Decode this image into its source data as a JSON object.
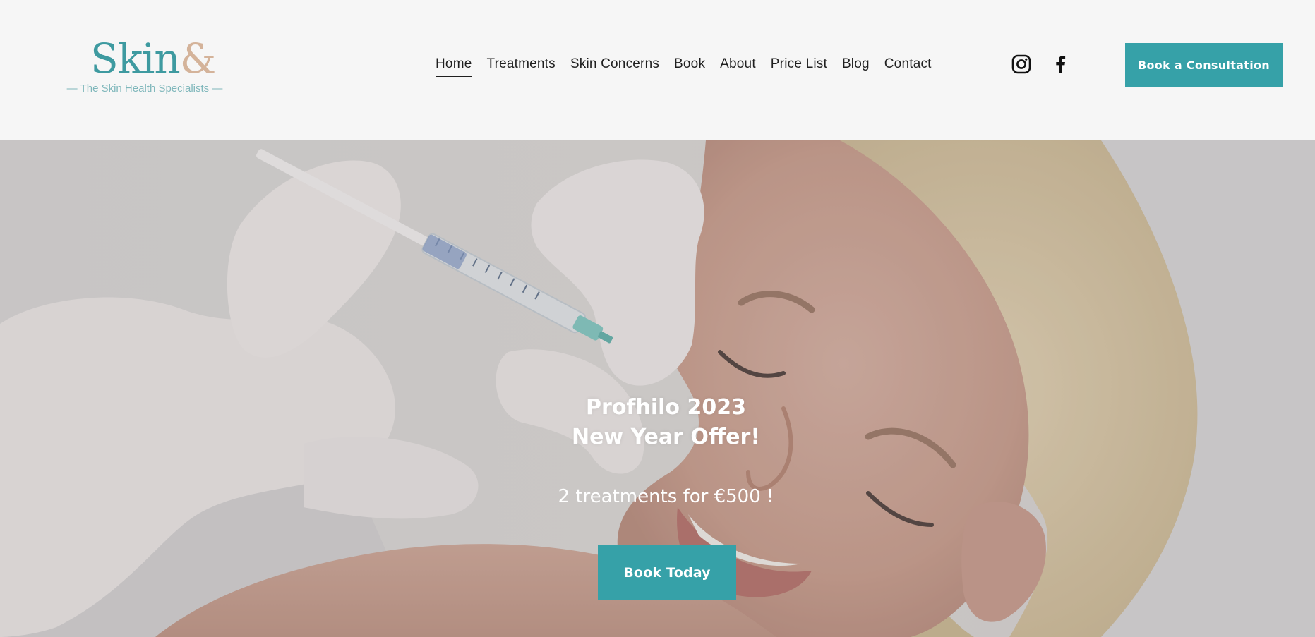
{
  "header": {
    "logo": {
      "word": "Skin",
      "amp": "&",
      "tagline": "— The Skin Health Specialists —"
    },
    "nav": [
      {
        "label": "Home",
        "active": true
      },
      {
        "label": "Treatments",
        "active": false
      },
      {
        "label": "Skin Concerns",
        "active": false
      },
      {
        "label": "Book",
        "active": false
      },
      {
        "label": "About",
        "active": false
      },
      {
        "label": "Price List",
        "active": false
      },
      {
        "label": "Blog",
        "active": false
      },
      {
        "label": "Contact",
        "active": false
      }
    ],
    "social": [
      {
        "icon": "instagram-icon"
      },
      {
        "icon": "facebook-icon"
      }
    ],
    "cta_label": "Book a Consultation"
  },
  "hero": {
    "title_line1": "Profhilo 2023",
    "title_line2": "New Year Offer!",
    "offer": "2 treatments for €500 !",
    "cta_label": "Book Today"
  },
  "colors": {
    "accent": "#36a1a8",
    "logo_teal": "#3e9aa0",
    "logo_beige": "#d4b39a",
    "header_bg": "#f6f6f6",
    "text_dark": "#1f1f1f"
  }
}
